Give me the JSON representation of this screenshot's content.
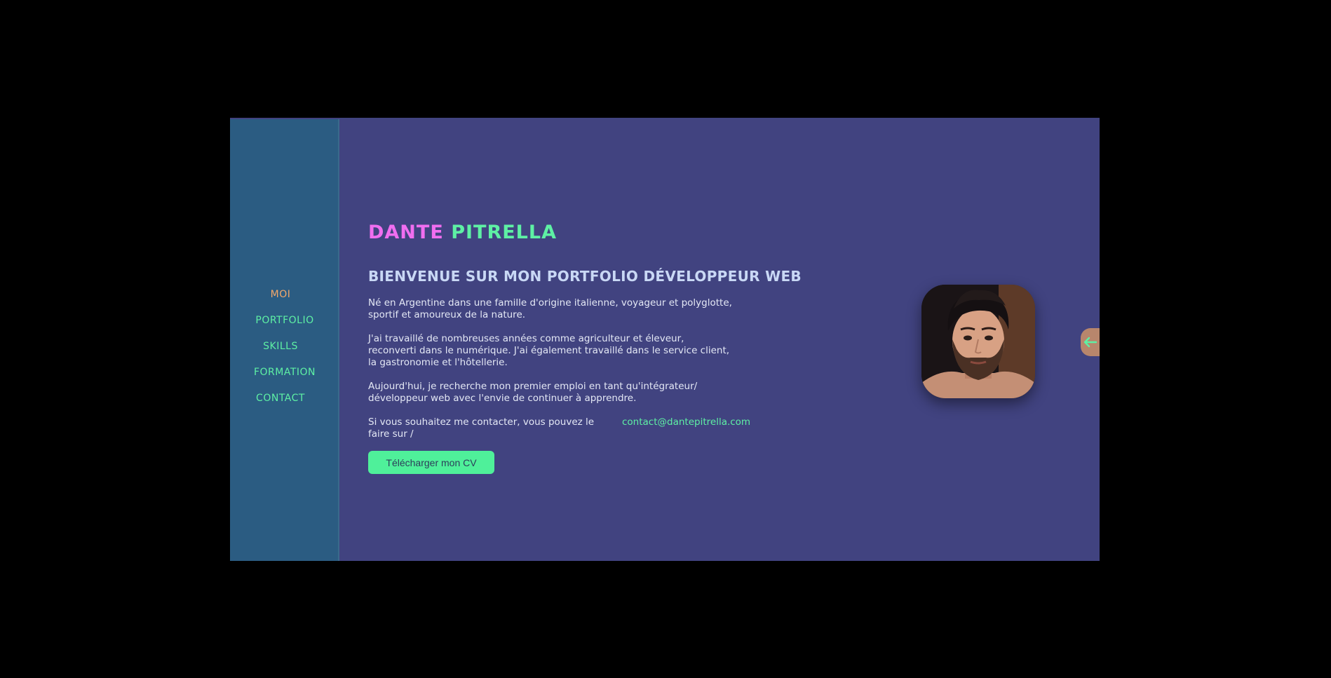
{
  "nav": {
    "items": [
      {
        "label": "MOI",
        "active": true
      },
      {
        "label": "PORTFOLIO",
        "active": false
      },
      {
        "label": "SKILLS",
        "active": false
      },
      {
        "label": "FORMATION",
        "active": false
      },
      {
        "label": "CONTACT",
        "active": false
      }
    ]
  },
  "hero": {
    "first_name": "DANTE",
    "last_name": "PITRELLA",
    "headline": "BIENVENUE SUR MON PORTFOLIO DÉVELOPPEUR WEB",
    "paragraphs": [
      "Né en Argentine dans une famille d'origine italienne, voyageur et polyglotte,\nsportif et amoureux de la nature.",
      "J'ai travaillé de nombreuses années comme agriculteur et éleveur,\nreconverti dans le numérique. J'ai également travaillé dans le service client,\nla gastronomie et l'hôtellerie.",
      "Aujourd'hui, je recherche mon premier emploi en tant qu'intégrateur/\ndéveloppeur web avec l'envie de continuer à apprendre.",
      "Si vous souhaitez me contacter, vous pouvez le\nfaire sur /"
    ],
    "email": "contact@dantepitrella.com",
    "cv_button": "Télécharger mon CV"
  },
  "icons": {
    "back_tab": "arrow-left-icon",
    "avatar": "profile-photo"
  },
  "colors": {
    "background": "#414380",
    "sidebar": "#2b5c82",
    "accent_green": "#5ef0a4",
    "accent_pink": "#f06ef0",
    "active_nav": "#f3a86b",
    "tab": "#b8866c"
  }
}
